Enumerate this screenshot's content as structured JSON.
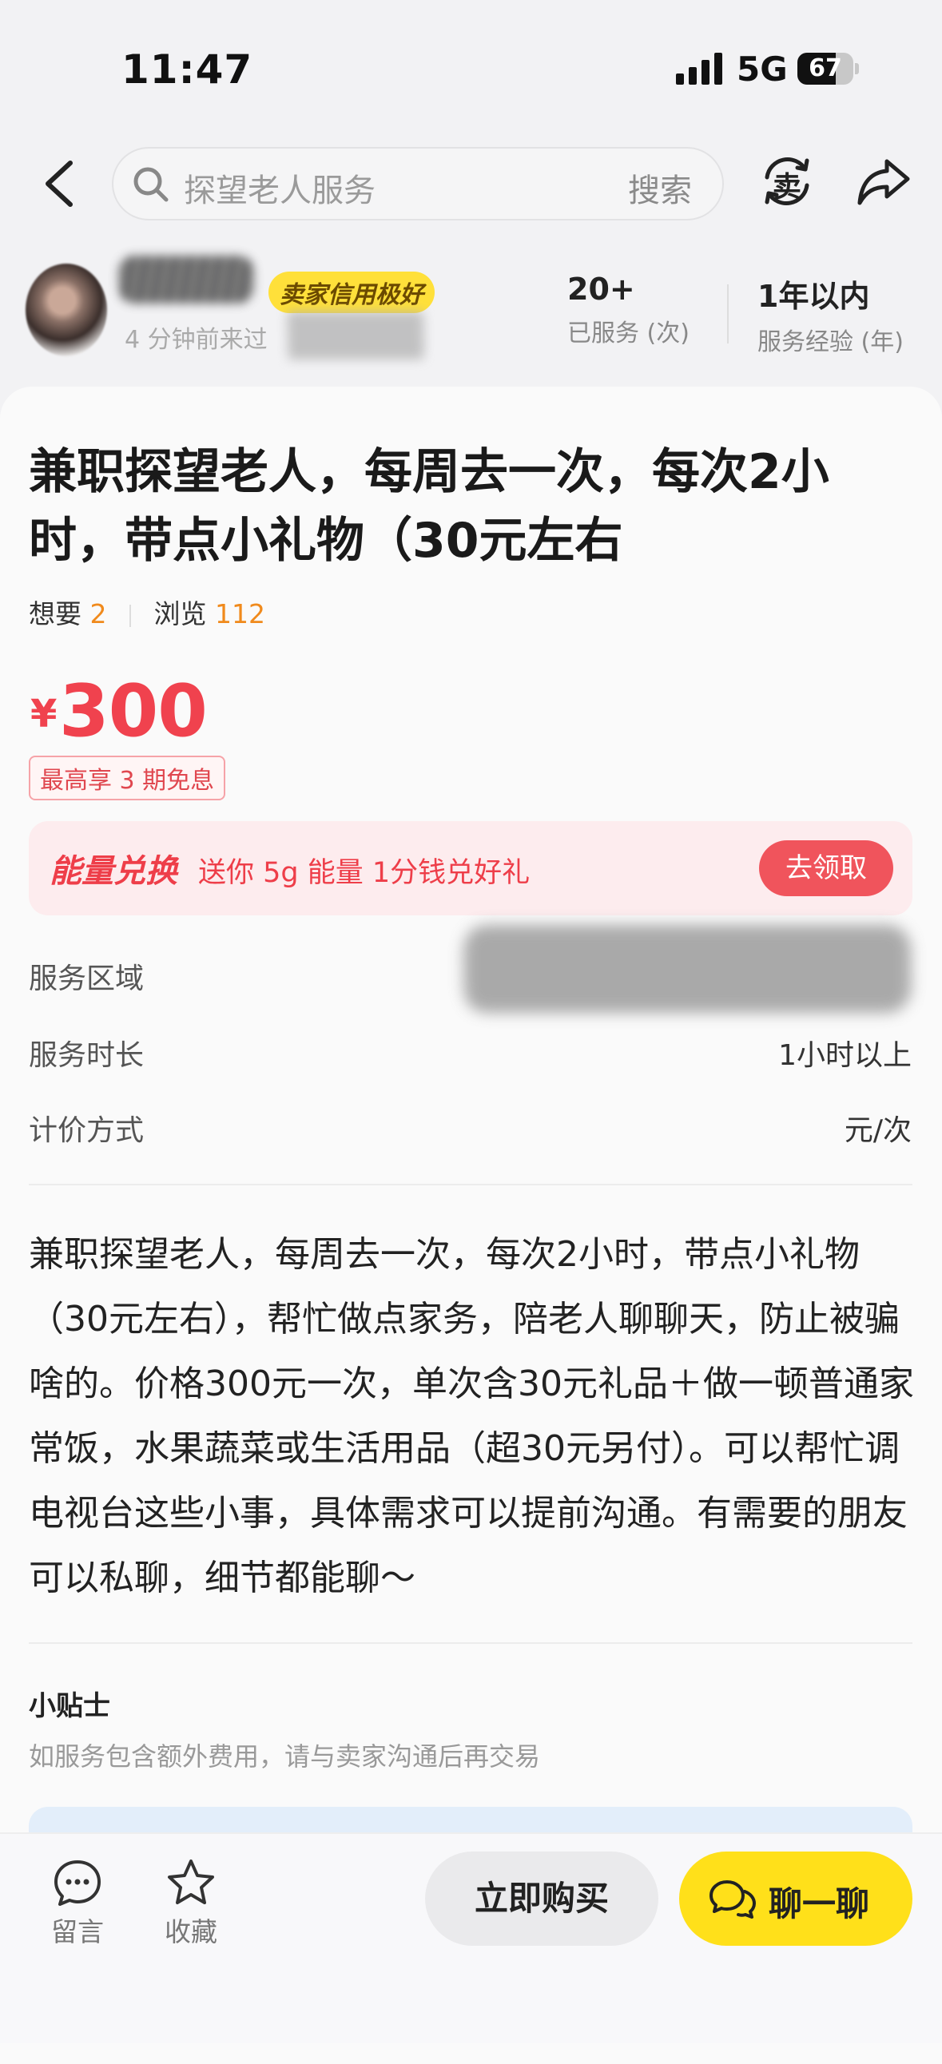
{
  "status_bar": {
    "time": "11:47",
    "network": "5G",
    "battery": "67"
  },
  "nav": {
    "search_placeholder": "探望老人服务",
    "search_button": "搜索",
    "sell_icon_char": "卖"
  },
  "seller": {
    "badge": "卖家信用极好",
    "last_seen": "4 分钟前来过",
    "stats": [
      {
        "value": "20+",
        "label": "已服务 (次)"
      },
      {
        "value": "1年以内",
        "label": "服务经验 (年)"
      }
    ]
  },
  "listing": {
    "title": "兼职探望老人，每周去一次，每次2小时，带点小礼物（30元左右",
    "want_label": "想要",
    "want_count": "2",
    "views_label": "浏览",
    "views_count": "112",
    "currency": "¥",
    "price": "300",
    "installment_tag": "最高享 3 期免息"
  },
  "energy_banner": {
    "title": "能量兑换",
    "desc": "送你 5g 能量 1分钱兑好礼",
    "button": "去领取"
  },
  "details": [
    {
      "label": "服务区域",
      "value": ""
    },
    {
      "label": "服务时长",
      "value": "1小时以上"
    },
    {
      "label": "计价方式",
      "value": "元/次"
    }
  ],
  "description": "兼职探望老人，每周去一次，每次2小时，带点小礼物（30元左右），帮忙做点家务，陪老人聊聊天，防止被骗啥的。价格300元一次，单次含30元礼品＋做一顿普通家常饭，水果蔬菜或生活用品（超30元另付）。可以帮忙调电视台这些小事，具体需求可以提前沟通。有需要的朋友可以私聊，细节都能聊～",
  "tips": {
    "title": "小贴士",
    "text": "如服务包含额外费用，请与卖家沟通后再交易"
  },
  "bottom_bar": {
    "comment_label": "留言",
    "favorite_label": "收藏",
    "buy_button": "立即购买",
    "chat_button": "聊一聊"
  },
  "colors": {
    "price_red": "#f0424e",
    "accent_yellow": "#ffe01a",
    "orange_count": "#f08a1c"
  }
}
